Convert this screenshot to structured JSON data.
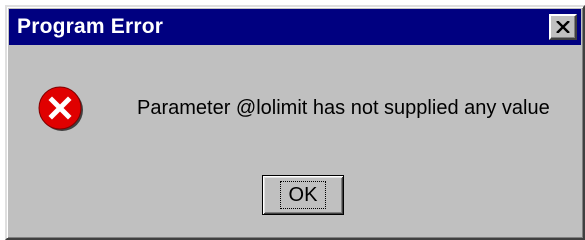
{
  "dialog": {
    "title": "Program Error",
    "message": "Parameter @lolimit has not supplied any value",
    "ok_label": "OK",
    "icon": "error-icon"
  },
  "colors": {
    "titlebar": "#000080",
    "window": "#c0c0c0",
    "error_red": "#e00000"
  }
}
